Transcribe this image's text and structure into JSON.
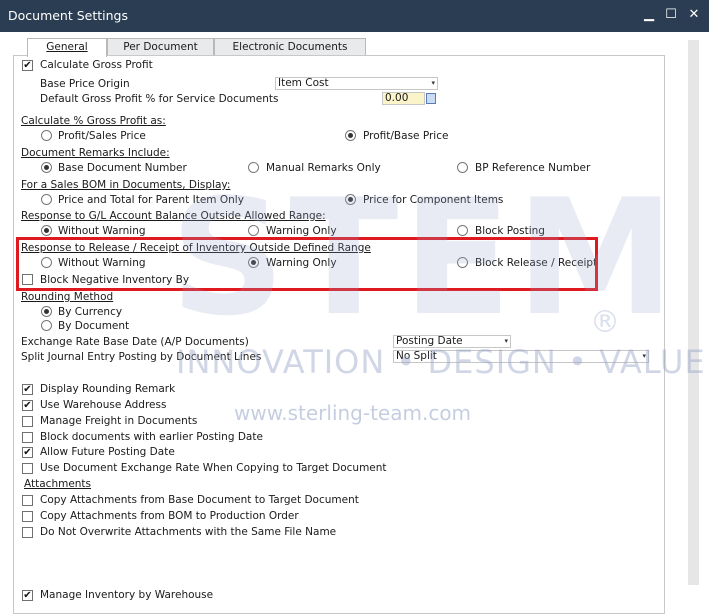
{
  "window": {
    "title": "Document Settings",
    "minimize": "▁",
    "maximize": "☐",
    "close": "✕"
  },
  "tabs": [
    "General",
    "Per Document",
    "Electronic Documents"
  ],
  "gross_profit": {
    "calc_gross_profit": "Calculate Gross Profit",
    "base_price_origin_label": "Base Price Origin",
    "base_price_origin_value": "Item Cost",
    "default_gp_label": "Default Gross Profit % for Service Documents",
    "default_gp_value": "0.00"
  },
  "calc_gp_as": {
    "label": "Calculate % Gross Profit as:",
    "opt1": "Profit/Sales Price",
    "opt2": "Profit/Base Price"
  },
  "remarks": {
    "label": "Document Remarks Include:",
    "opt1": "Base Document Number",
    "opt2": "Manual Remarks Only",
    "opt3": "BP Reference Number"
  },
  "sales_bom": {
    "label": "For a Sales BOM in Documents, Display:",
    "opt1": "Price and Total for Parent Item Only",
    "opt2": "Price for Component Items"
  },
  "gl_response": {
    "label": "Response to G/L Account Balance Outside Allowed Range:",
    "opt1": "Without Warning",
    "opt2": "Warning Only",
    "opt3": "Block Posting"
  },
  "inventory_response": {
    "label": "Response to Release / Receipt of Inventory Outside Defined Range",
    "opt1": "Without Warning",
    "opt2": "Warning Only",
    "opt3": "Block Release / Receipt",
    "block_negative": "Block Negative Inventory By"
  },
  "rounding": {
    "label": "Rounding Method",
    "opt1": "By Currency",
    "opt2": "By Document"
  },
  "exchange": {
    "label": "Exchange Rate Base Date (A/P Documents)",
    "value": "Posting Date"
  },
  "split_je": {
    "label": "Split Journal Entry Posting by Document Lines",
    "value": "No Split"
  },
  "options": [
    "Display Rounding Remark",
    "Use Warehouse Address",
    "Manage Freight in Documents",
    "Block documents with earlier Posting Date",
    "Allow Future Posting Date",
    "Use Document Exchange Rate When Copying to Target Document"
  ],
  "attachments": {
    "label": "Attachments",
    "items": [
      "Copy Attachments from Base Document to Target Document",
      "Copy Attachments from BOM to Production Order",
      "Do Not Overwrite Attachments with the Same File Name"
    ]
  },
  "manage_inventory": "Manage Inventory by Warehouse",
  "watermark": {
    "brand": "STEM",
    "registered": "®",
    "tagline": "INNOVATION • DESIGN • VALUE",
    "url": "www.sterling-team.com"
  },
  "check": "✔",
  "dropdown_arrow": "▾"
}
